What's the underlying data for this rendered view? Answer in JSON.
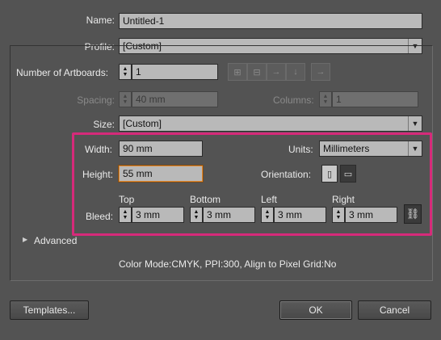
{
  "name": {
    "label": "Name:",
    "value": "Untitled-1"
  },
  "profile": {
    "label": "Profile:",
    "value": "[Custom]"
  },
  "artboards": {
    "label": "Number of Artboards:",
    "value": "1"
  },
  "spacing": {
    "label": "Spacing:",
    "value": "40 mm"
  },
  "columns": {
    "label": "Columns:",
    "value": "1"
  },
  "size": {
    "label": "Size:",
    "value": "[Custom]"
  },
  "width": {
    "label": "Width:",
    "value": "90 mm"
  },
  "height": {
    "label": "Height:",
    "value": "55 mm"
  },
  "units": {
    "label": "Units:",
    "value": "Millimeters"
  },
  "orientation": {
    "label": "Orientation:",
    "selected": "portrait"
  },
  "bleed": {
    "label": "Bleed:",
    "top": {
      "label": "Top",
      "value": "3 mm"
    },
    "bottom": {
      "label": "Bottom",
      "value": "3 mm"
    },
    "left": {
      "label": "Left",
      "value": "3 mm"
    },
    "right": {
      "label": "Right",
      "value": "3 mm"
    }
  },
  "advanced": {
    "label": "Advanced"
  },
  "info": "Color Mode:CMYK, PPI:300, Align to Pixel Grid:No",
  "buttons": {
    "templates": "Templates...",
    "ok": "OK",
    "cancel": "Cancel"
  },
  "colors": {
    "background": "#535353",
    "highlight": "#d62a7a",
    "field": "#b9b9b9",
    "focus": "#e48a2e"
  }
}
